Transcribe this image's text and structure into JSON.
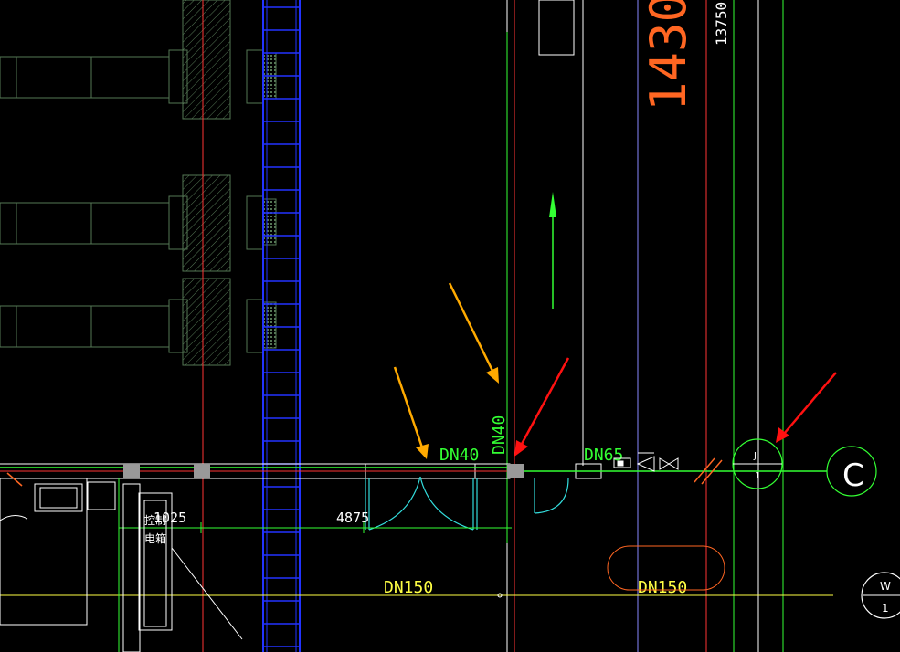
{
  "drawing": {
    "background": "#000000",
    "colors": {
      "green": "#33ff33",
      "red": "#ff3333",
      "blue": "#2233ff",
      "yellow": "#ffff44",
      "cyan": "#33dddd",
      "white": "#ffffff",
      "orange": "#ff6622",
      "arrow_orange": "#ffaa00",
      "arrow_red": "#ff1111",
      "grey": "#999999"
    },
    "labels": {
      "pipe_dn40_h": "DN40",
      "pipe_dn40_v": "DN40",
      "pipe_dn65": "DN65",
      "pipe_dn150_left": "DN150",
      "pipe_dn150_right": "DN150",
      "dim_13750": "13750",
      "dim_14300": "1430",
      "dim_1025": "1025",
      "dim_4875": "4875",
      "panel_line1": "控制",
      "panel_line2": "电箱",
      "node_j": "J",
      "node_1": "1",
      "axis_c": "C",
      "axis_w": "W",
      "axis_w_num": "1"
    }
  }
}
